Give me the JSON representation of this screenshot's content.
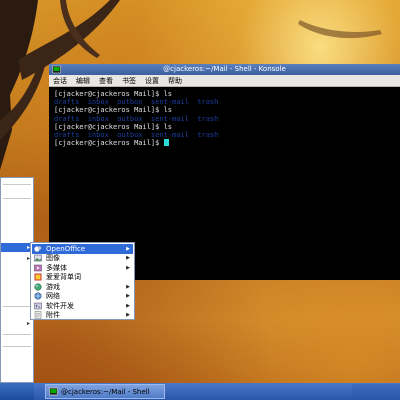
{
  "window": {
    "title": "@cjackeros:~/Mail - Shell - Konsole",
    "menu": [
      "会话",
      "编辑",
      "查看",
      "书签",
      "设置",
      "帮助"
    ]
  },
  "terminal": {
    "lines": [
      {
        "prompt": "[cjacker@cjackeros Mail]$",
        "cmd": " ls"
      },
      {
        "dirs": "drafts  inbox  outbox  sent-mail  trash"
      },
      {
        "prompt": "[cjacker@cjackeros Mail]$",
        "cmd": " ls"
      },
      {
        "dirs": "drafts  inbox  outbox  sent-mail  trash"
      },
      {
        "prompt": "[cjacker@cjackeros Mail]$",
        "cmd": " ls"
      },
      {
        "dirs": "drafts  inbox  outbox  sent-mail  trash"
      },
      {
        "prompt": "[cjacker@cjackeros Mail]$",
        "cmd": " ",
        "cursor": true
      }
    ]
  },
  "submenu": {
    "items": [
      {
        "label": "OpenOffice",
        "icon": "openoffice-icon",
        "highlighted": true
      },
      {
        "label": "图像",
        "icon": "graphics-icon"
      },
      {
        "label": "多媒体",
        "icon": "multimedia-icon"
      },
      {
        "label": "爱爱背单词",
        "icon": "dictionary-icon"
      },
      {
        "label": "游戏",
        "icon": "games-icon"
      },
      {
        "label": "网络",
        "icon": "internet-icon"
      },
      {
        "label": "软件开发",
        "icon": "development-icon"
      },
      {
        "label": "附件",
        "icon": "accessories-icon"
      }
    ]
  },
  "taskbar": {
    "task_label": "@cjackeros:~/Mail - Shell"
  },
  "colors": {
    "highlight": "#2f6bd8",
    "taskbar": "#2b56a8",
    "cursor": "#2adbd8",
    "dir_text": "#1a3fa0"
  }
}
